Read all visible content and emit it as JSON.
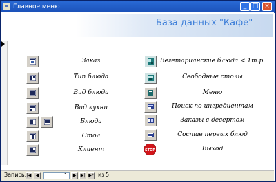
{
  "window": {
    "title": "Главное меню",
    "minimize": "_",
    "maximize": "□",
    "close": "×"
  },
  "header": {
    "title": "База данных \"Кафе\""
  },
  "menu_left": [
    {
      "label": "Заказ",
      "icon": "form-icon"
    },
    {
      "label": "Тип блюда",
      "icon": "form-icon"
    },
    {
      "label": "Вид блюда",
      "icon": "form-icon"
    },
    {
      "label": "Вид кухни",
      "icon": "form-icon"
    },
    {
      "label": "Блюда",
      "icon": "form-icon"
    },
    {
      "label": "Стол",
      "icon": "form-icon"
    },
    {
      "label": "Клиент",
      "icon": "form-icon"
    }
  ],
  "menu_right": [
    {
      "label": "Вегетарианские блюда < 1т.р.",
      "icon": "query-icon"
    },
    {
      "label": "Свободные столы",
      "icon": "query-icon"
    },
    {
      "label": "Меню",
      "icon": "report-icon"
    },
    {
      "label": "Поиск по ингредиентам",
      "icon": "query-icon"
    },
    {
      "label": "Заказы с десертом",
      "icon": "query-icon"
    },
    {
      "label": "Состав первых блюд",
      "icon": "query-icon"
    },
    {
      "label": "Выход",
      "icon": "stop-icon"
    }
  ],
  "nav": {
    "caption": "Запись:",
    "current": "1",
    "of": "из",
    "total": "5"
  },
  "colors": {
    "title_bar": "#1a4fb6",
    "header_text": "#3b7dd8",
    "header_gradient": "#c7d9ef"
  }
}
